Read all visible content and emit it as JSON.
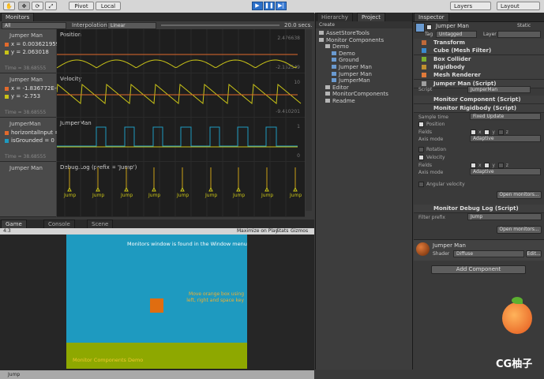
{
  "toolbar": {
    "pivot_label": "Pivot",
    "local_label": "Local",
    "layers_label": "Layers",
    "layout_label": "Layout"
  },
  "monitors": {
    "tab_label": "Monitors",
    "filter_value": "All",
    "interpolation_label": "Interpolation",
    "interpolation_value": "Linear",
    "duration": "20.0 secs.",
    "rows": [
      {
        "name": "Jumper Man",
        "values": [
          "x = 0.003621959",
          "y = 2.063018"
        ],
        "time": "Time = 38.68555",
        "title": "Position",
        "max": "2.476638",
        "min": "-2.152549"
      },
      {
        "name": "Jumper Man",
        "values": [
          "x = -1.836772E-07",
          "y = -2.753"
        ],
        "time": "Time = 38.68555",
        "title": "Velocity",
        "max": "10",
        "min": "-9.410201"
      },
      {
        "name": "JumperMan",
        "values": [
          "horizontalInput = 0",
          "isGrounded = 0"
        ],
        "time": "Time = 38.68555",
        "title": "JumperMan",
        "max": "1",
        "min": "0"
      },
      {
        "name": "Jumper Man",
        "values": [],
        "time": "Time = 38.68555",
        "title": "Debug.Log (prefix = 'Jump')",
        "max": "",
        "min": ""
      }
    ],
    "jump_labels": [
      "Jump",
      "Jump",
      "Jump",
      "Jump",
      "Jump",
      "Jump",
      "Jump",
      "Jump",
      "Jump"
    ]
  },
  "game": {
    "tabs": [
      "Game",
      "Console",
      "Scene"
    ],
    "aspect": "4:3",
    "maximize": "Maximize on Play",
    "stats": "Stats",
    "gizmos": "Gizmos",
    "title_text": "Monitors window is found in the Window menu",
    "instruction_text": "Move orange box using left, right and space key",
    "footer_text": "Monitor Components Demo",
    "status": "Jump"
  },
  "hierarchy": {
    "tabs": [
      "Hierarchy",
      "Project"
    ],
    "create_label": "Create",
    "items": [
      {
        "label": "AssetStoreTools",
        "indent": 0
      },
      {
        "label": "Monitor Components",
        "indent": 0
      },
      {
        "label": "Demo",
        "indent": 1
      },
      {
        "label": "Demo",
        "indent": 2
      },
      {
        "label": "Ground",
        "indent": 2
      },
      {
        "label": "Jumper Man",
        "indent": 2
      },
      {
        "label": "Jumper Man",
        "indent": 2
      },
      {
        "label": "JumperMan",
        "indent": 2
      },
      {
        "label": "Editor",
        "indent": 1
      },
      {
        "label": "MonitorComponents",
        "indent": 1
      },
      {
        "label": "Readme",
        "indent": 1
      }
    ]
  },
  "inspector": {
    "tab_label": "Inspector",
    "object_name": "Jumper Man",
    "static_label": "Static",
    "tag_label": "Tag",
    "tag_value": "Untagged",
    "layer_label": "Layer",
    "components": [
      "Transform",
      "Cube (Mesh Filter)",
      "Box Collider",
      "Rigidbody",
      "Mesh Renderer",
      "Jumper Man (Script)"
    ],
    "script_label": "Script",
    "script_value": "JumperMan",
    "monitor_component": "Monitor Component (Script)",
    "monitor_rigidbody": "Monitor Rigidbody (Script)",
    "sample_time_label": "Sample time",
    "sample_time_value": "Fixed Update",
    "position_label": "Position",
    "fields_label": "Fields",
    "axis_mode_label": "Axis mode",
    "axis_mode_value": "Adaptive",
    "rotation_label": "Rotation",
    "velocity_label": "Velocity",
    "angular_label": "Angular velocity",
    "x_label": "x",
    "y_label": "y",
    "z_label": "z",
    "open_monitors": "Open monitors...",
    "debug_log": "Monitor Debug Log (Script)",
    "filter_prefix_label": "Filter prefix",
    "filter_prefix_value": "Jump",
    "material_name": "Jumper Man",
    "shader_label": "Shader",
    "shader_value": "Diffuse",
    "edit_label": "Edit...",
    "add_component": "Add Component"
  },
  "watermark": "CG柚子",
  "colors": {
    "game_sky": "#1e9ac0",
    "game_ground": "#8ea800",
    "orange_box": "#e06d10",
    "graph_line": "#c9c317",
    "graph_line2": "#e26a2c",
    "graph_line3": "#1e9ac0"
  }
}
